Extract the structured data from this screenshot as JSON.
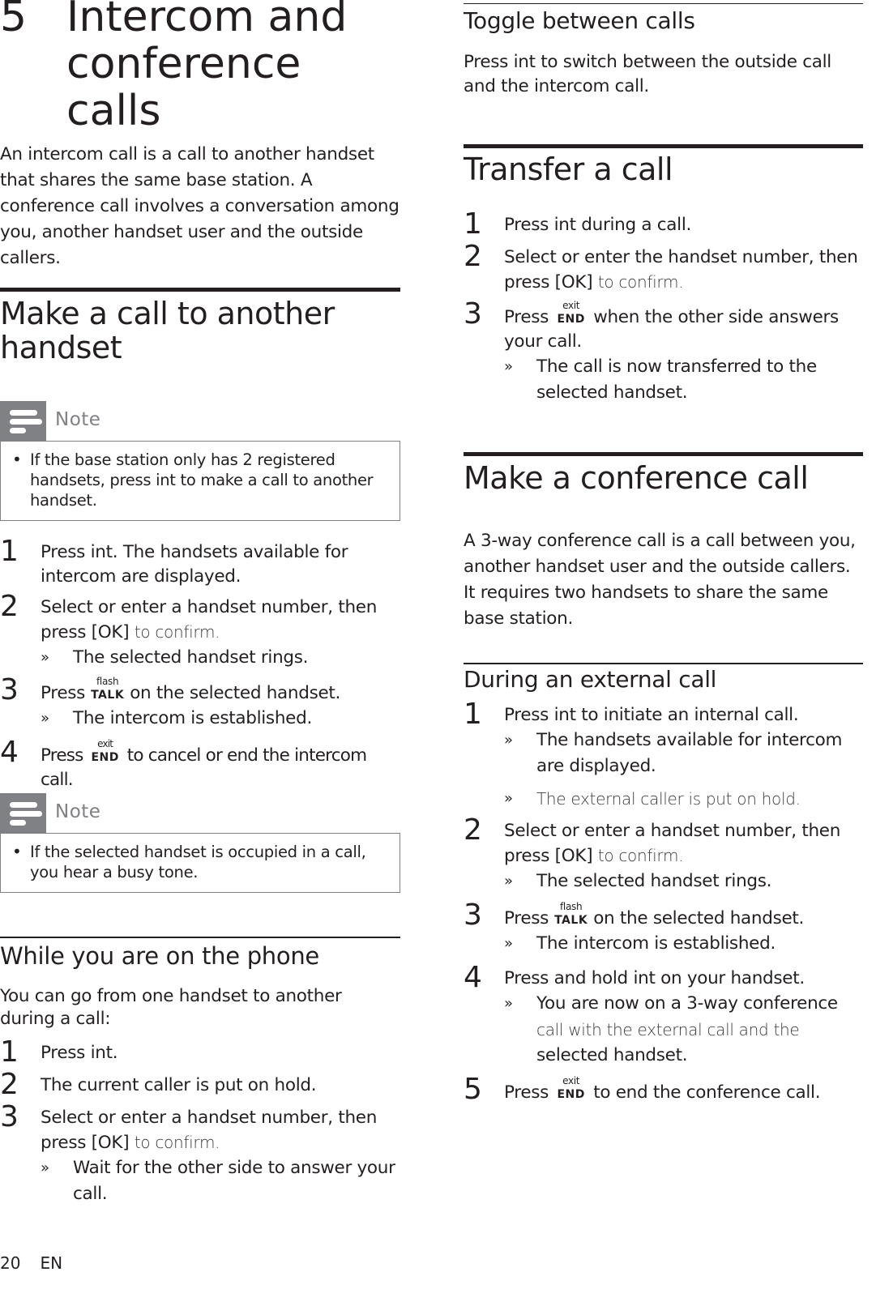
{
  "chapter": {
    "number": "5",
    "title_line1": "Intercom and",
    "title_line2": "conference calls"
  },
  "intro": "An intercom call is a call to another handset that shares the same base station. A conference call involves a conversation among you, another handset user and the outside callers.",
  "make_call": {
    "heading_line1": "Make a call to another",
    "heading_line2": "handset",
    "note1": {
      "label": "Note",
      "bullet": "•",
      "text": "If the base station only has 2 registered handsets, press int to make a call to another handset."
    },
    "steps": [
      {
        "num": "1",
        "text": "Press int. The handsets available for intercom are displayed."
      },
      {
        "num": "2",
        "text": "Select or enter a handset number, then press [OK]",
        "suffix": "to confirm.",
        "result": "The selected handset rings."
      },
      {
        "num": "3",
        "pre": "Press",
        "key_top": "flash",
        "key_bottom": "TALK",
        "post": "on the selected handset.",
        "result": "The intercom is established."
      },
      {
        "num": "4",
        "pre": "Press",
        "key_top": "exit",
        "key_bottom": "END",
        "post": "to cancel or end the intercom call."
      }
    ],
    "note2": {
      "label": "Note",
      "bullet": "•",
      "text": "If the selected handset is occupied in a call, you hear a busy tone."
    }
  },
  "while_on_phone": {
    "heading": "While you are on the phone",
    "intro": "You can go from one handset to another during a call:",
    "steps": [
      {
        "num": "1",
        "text": "Press int."
      },
      {
        "num": "2",
        "text": "The current caller is put on hold."
      },
      {
        "num": "3",
        "text": "Select or enter a handset number, then press [OK]",
        "suffix": "to confirm.",
        "result": "Wait for the other side to answer your call."
      }
    ]
  },
  "toggle": {
    "heading": "Toggle between calls",
    "text": "Press int to switch between the outside call and the intercom call."
  },
  "transfer": {
    "heading": "Transfer a call",
    "steps": [
      {
        "num": "1",
        "text": "Press int during a call."
      },
      {
        "num": "2",
        "text": "Select or enter the handset number, then press [OK]",
        "suffix": "to confirm."
      },
      {
        "num": "3",
        "pre": "Press",
        "key_top": "exit",
        "key_bottom": "END",
        "post": "when the other side answers your call.",
        "result": "The call is now transferred to the selected handset."
      }
    ]
  },
  "conference": {
    "heading": "Make a conference call",
    "intro": "A 3-way conference call is a call between you, another handset user and the outside callers. It requires two handsets to share the same base station.",
    "subheading": "During an external call",
    "steps": [
      {
        "num": "1",
        "text": "Press int to initiate an internal call.",
        "result": "The handsets available for intercom are displayed.",
        "result2": "The external caller is put on hold."
      },
      {
        "num": "2",
        "text": "Select or enter a handset number, then press [OK]",
        "suffix": "to confirm.",
        "result": "The selected handset rings."
      },
      {
        "num": "3",
        "pre": "Press",
        "key_top": "flash",
        "key_bottom": "TALK",
        "post": "on the selected handset.",
        "result": "The intercom is established."
      },
      {
        "num": "4",
        "text": "Press and hold int on your handset.",
        "result_a": "You are now on a 3-way conference",
        "result_b": "call with the external call and the",
        "result_c": "selected handset."
      },
      {
        "num": "5",
        "pre": "Press",
        "key_top": "exit",
        "key_bottom": "END",
        "post": "to end the conference call."
      }
    ]
  },
  "footer": {
    "page": "20",
    "lang": "EN"
  },
  "symbols": {
    "raquo": "»"
  }
}
